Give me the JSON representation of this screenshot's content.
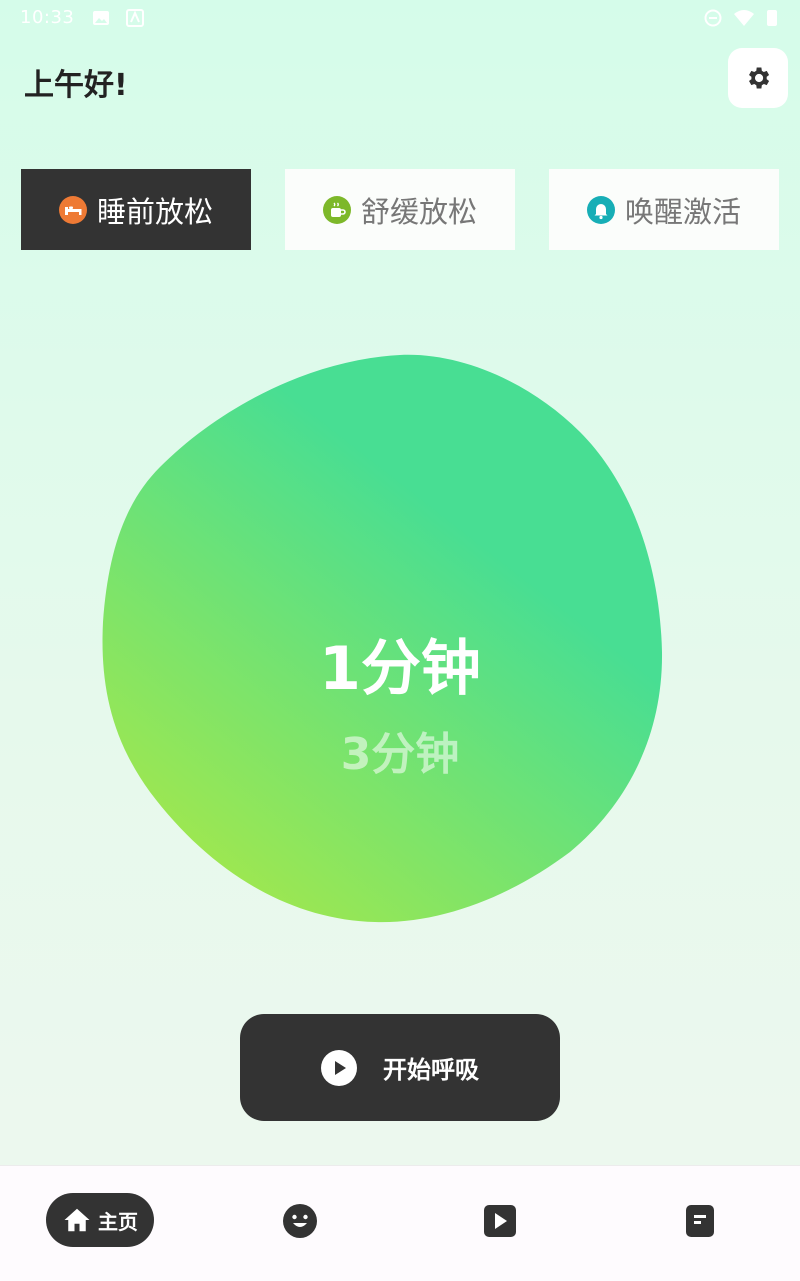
{
  "status_bar": {
    "time": "10:33"
  },
  "header": {
    "greeting": "上午好!"
  },
  "tabs": [
    {
      "label": "睡前放松",
      "icon": "bed-icon",
      "color": "#ee7a35",
      "active": true
    },
    {
      "label": "舒缓放松",
      "icon": "coffee-cup-icon",
      "color": "#7db82a",
      "active": false
    },
    {
      "label": "唤醒激活",
      "icon": "alarm-bell-icon",
      "color": "#17aeb6",
      "active": false
    }
  ],
  "duration": {
    "selected": "1分钟",
    "next": "3分钟"
  },
  "start_button": {
    "label": "开始呼吸"
  },
  "bottom_nav": {
    "home_label": "主页"
  },
  "colors": {
    "dark": "#333333",
    "blob_start": "#a6e84a",
    "blob_end": "#48de93"
  }
}
